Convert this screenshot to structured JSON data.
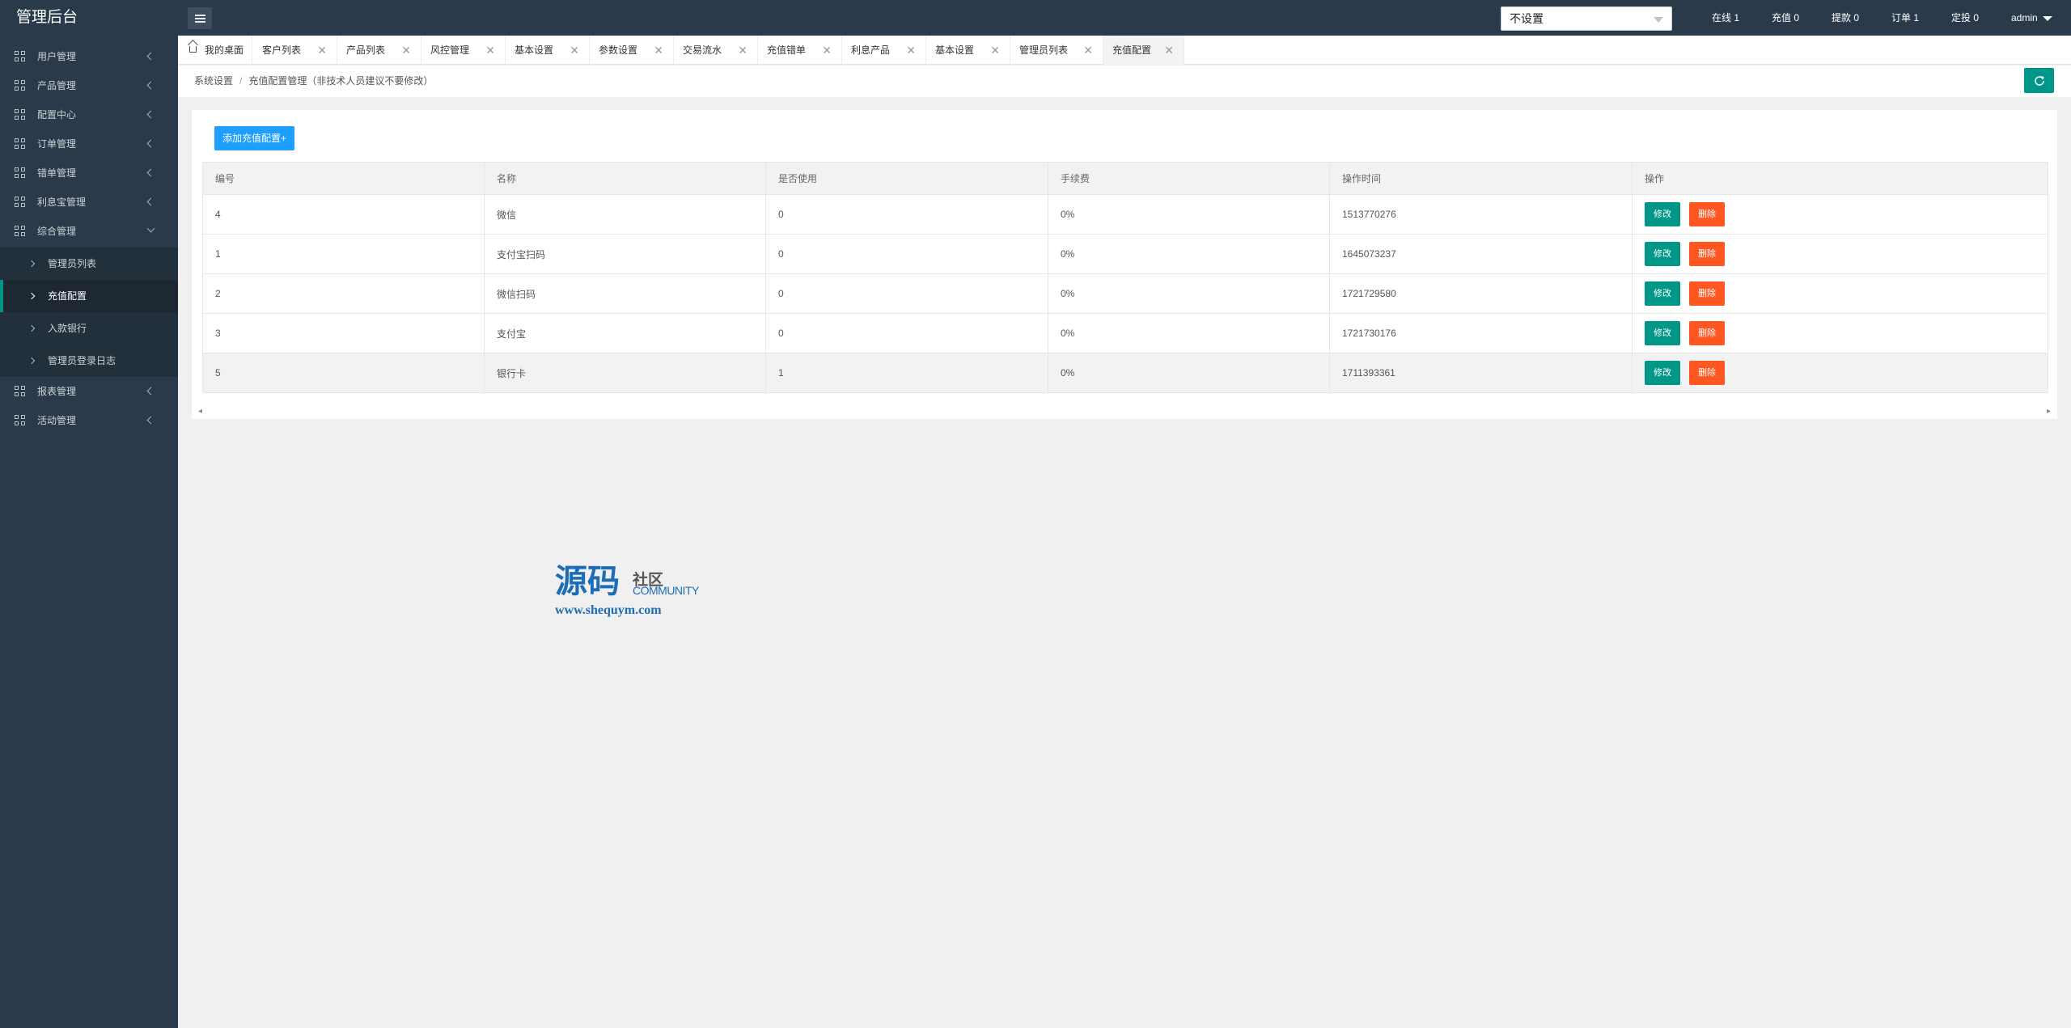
{
  "app": {
    "title": "管理后台"
  },
  "header": {
    "select_value": "不设置",
    "stats": [
      "在线 1",
      "充值 0",
      "提款 0",
      "订单 1",
      "定投 0"
    ],
    "user": "admin"
  },
  "sidebar": {
    "items": [
      {
        "label": "用户管理"
      },
      {
        "label": "产品管理"
      },
      {
        "label": "配置中心"
      },
      {
        "label": "订单管理"
      },
      {
        "label": "错单管理"
      },
      {
        "label": "利息宝管理"
      },
      {
        "label": "综合管理"
      }
    ],
    "subitems": [
      {
        "label": "管理员列表"
      },
      {
        "label": "充值配置"
      },
      {
        "label": "入款银行"
      },
      {
        "label": "管理员登录日志"
      }
    ],
    "bottom_items": [
      {
        "label": "报表管理"
      },
      {
        "label": "活动管理"
      }
    ]
  },
  "tabs": [
    {
      "label": "我的桌面"
    },
    {
      "label": "客户列表"
    },
    {
      "label": "产品列表"
    },
    {
      "label": "风控管理"
    },
    {
      "label": "基本设置"
    },
    {
      "label": "参数设置"
    },
    {
      "label": "交易流水"
    },
    {
      "label": "充值错单"
    },
    {
      "label": "利息产品"
    },
    {
      "label": "基本设置"
    },
    {
      "label": "管理员列表"
    },
    {
      "label": "充值配置"
    }
  ],
  "breadcrumb": {
    "root": "系统设置",
    "separator": "/",
    "current": "充值配置管理（非技术人员建议不要修改）"
  },
  "main": {
    "add_button": "添加充值配置+",
    "columns": [
      "编号",
      "名称",
      "是否使用",
      "手续费",
      "操作时间",
      "操作"
    ],
    "rows": [
      {
        "id": "4",
        "name": "微信",
        "enabled": "0",
        "fee": "0%",
        "time": "1513770276"
      },
      {
        "id": "1",
        "name": "支付宝扫码",
        "enabled": "0",
        "fee": "0%",
        "time": "1645073237"
      },
      {
        "id": "2",
        "name": "微信扫码",
        "enabled": "0",
        "fee": "0%",
        "time": "1721729580"
      },
      {
        "id": "3",
        "name": "支付宝",
        "enabled": "0",
        "fee": "0%",
        "time": "1721730176"
      },
      {
        "id": "5",
        "name": "银行卡",
        "enabled": "1",
        "fee": "0%",
        "time": "1711393361"
      }
    ],
    "edit_label": "修改",
    "delete_label": "删除"
  },
  "watermark": {
    "big": "源码",
    "small_cn": "社区",
    "small_en": "COMMUNITY",
    "url": "www.shequym.com"
  },
  "colors": {
    "topbar": "#2a3a4a",
    "primary": "#009688",
    "danger": "#ff5722",
    "blue": "#1e9fff"
  }
}
